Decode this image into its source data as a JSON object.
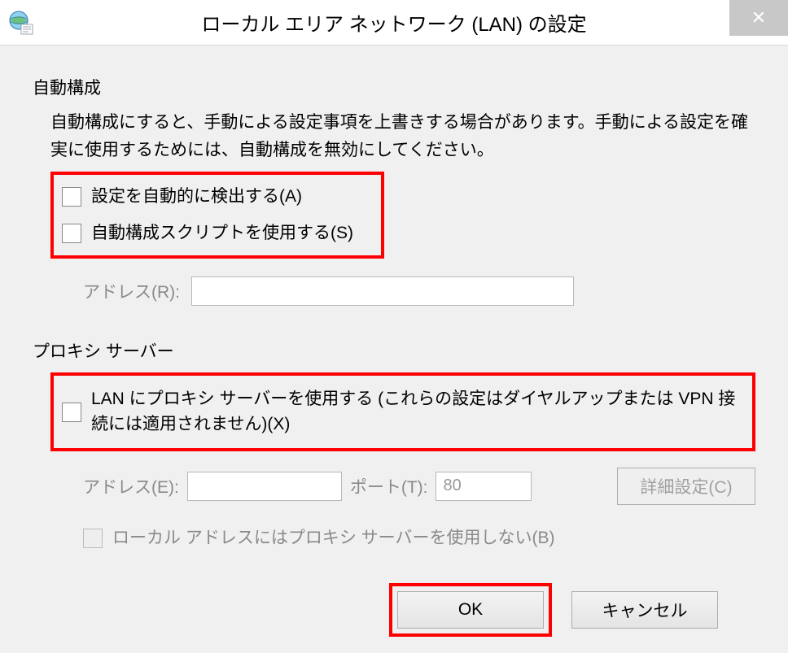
{
  "window": {
    "title": "ローカル エリア ネットワーク (LAN) の設定",
    "close_glyph": "✕"
  },
  "auto": {
    "legend": "自動構成",
    "description": "自動構成にすると、手動による設定事項を上書きする場合があります。手動による設定を確実に使用するためには、自動構成を無効にしてください。",
    "detect_label": "設定を自動的に検出する(A)",
    "script_label": "自動構成スクリプトを使用する(S)",
    "address_label": "アドレス(R):",
    "address_value": ""
  },
  "proxy": {
    "legend": "プロキシ サーバー",
    "use_label": "LAN にプロキシ サーバーを使用する (これらの設定はダイヤルアップまたは VPN 接続には適用されません)(X)",
    "address_label": "アドレス(E):",
    "address_value": "",
    "port_label": "ポート(T):",
    "port_value": "80",
    "advanced_label": "詳細設定(C)",
    "bypass_label": "ローカル アドレスにはプロキシ サーバーを使用しない(B)"
  },
  "footer": {
    "ok_label": "OK",
    "cancel_label": "キャンセル"
  }
}
